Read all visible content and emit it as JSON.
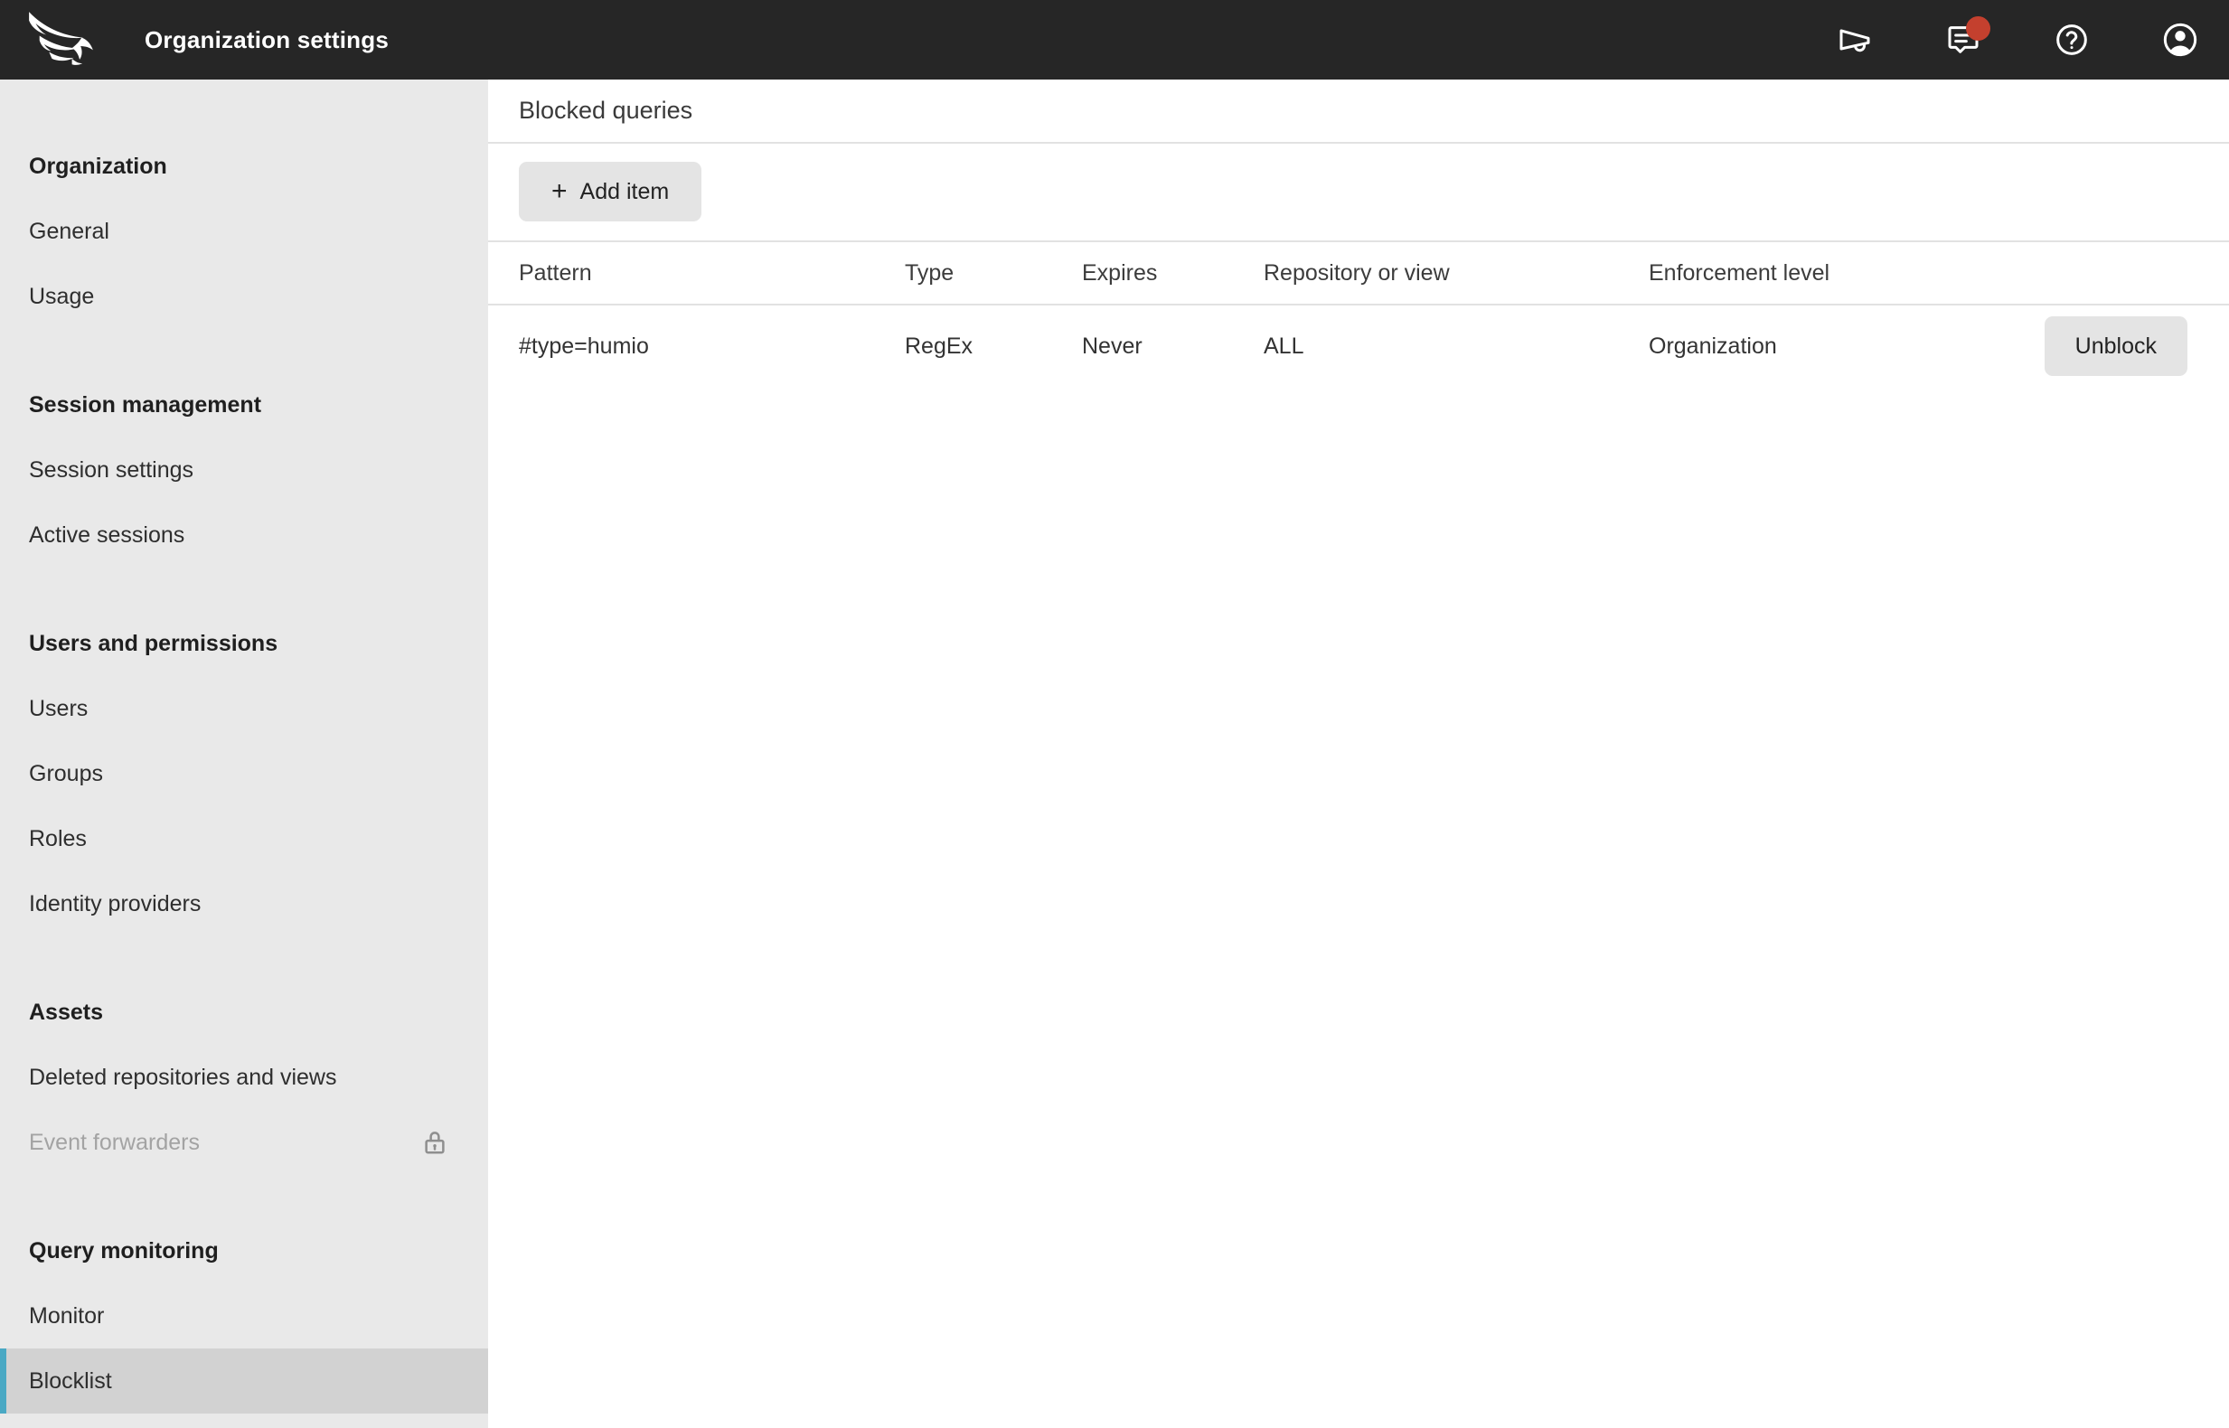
{
  "colors": {
    "topbar_bg": "#262626",
    "topbar_text": "#ffffff",
    "sidebar_bg": "#e9e9e9",
    "sidebar_selected_bg": "#d2d2d2",
    "accent_teal": "#4aa9c4",
    "badge_red": "#c4402e",
    "content_bg": "#ffffff",
    "divider": "#e2e2e2",
    "text_muted": "#a3a3a3",
    "button_bg": "#e4e4e4"
  },
  "topbar": {
    "title": "Organization settings",
    "icons": [
      "announcements",
      "feedback",
      "help",
      "account"
    ],
    "feedback_has_badge": true
  },
  "sidebar": {
    "sections": [
      {
        "header": "Organization",
        "items": [
          {
            "label": "General"
          },
          {
            "label": "Usage"
          }
        ]
      },
      {
        "header": "Session management",
        "items": [
          {
            "label": "Session settings"
          },
          {
            "label": "Active sessions"
          }
        ]
      },
      {
        "header": "Users and permissions",
        "items": [
          {
            "label": "Users"
          },
          {
            "label": "Groups"
          },
          {
            "label": "Roles"
          },
          {
            "label": "Identity providers"
          }
        ]
      },
      {
        "header": "Assets",
        "items": [
          {
            "label": "Deleted repositories and views"
          },
          {
            "label": "Event forwarders",
            "locked": true
          }
        ]
      },
      {
        "header": "Query monitoring",
        "items": [
          {
            "label": "Monitor"
          },
          {
            "label": "Blocklist",
            "selected": true
          }
        ]
      }
    ]
  },
  "main": {
    "title": "Blocked queries",
    "add_button": {
      "icon": "+",
      "label": "Add item"
    },
    "table": {
      "columns": [
        "Pattern",
        "Type",
        "Expires",
        "Repository or view",
        "Enforcement level"
      ],
      "rows": [
        {
          "pattern": "#type=humio",
          "type": "RegEx",
          "expires": "Never",
          "repository": "ALL",
          "enforcement": "Organization",
          "action": "Unblock"
        }
      ]
    }
  }
}
